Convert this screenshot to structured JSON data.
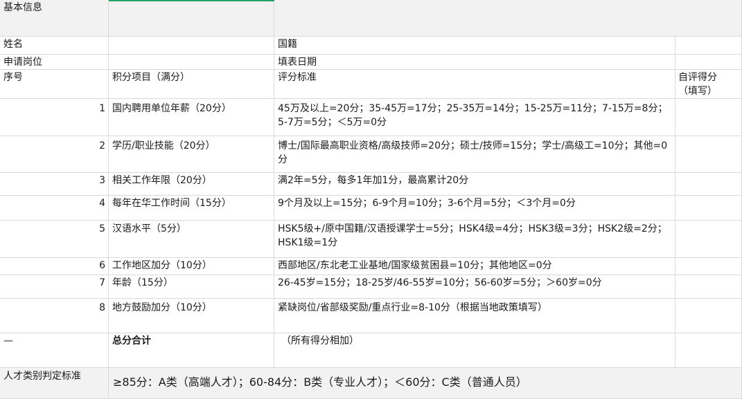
{
  "sheet": {
    "section_title": "基本信息",
    "name_label": "姓名",
    "nationality_label": "国籍",
    "position_label": "申请岗位",
    "date_label": "填表日期",
    "headers": {
      "index": "序号",
      "item": "积分项目（满分）",
      "criteria": "评分标准",
      "self_score": "自评得分（填写）"
    },
    "rows": [
      {
        "no": "1",
        "item": "国内聘用单位年薪（20分）",
        "criteria": "45万及以上=20分；35-45万=17分；25-35万=14分；15-25万=11分；7-15万=8分；5-7万=5分；＜5万=0分"
      },
      {
        "no": "2",
        "item": "学历/职业技能（20分）",
        "criteria": "博士/国际最高职业资格/高级技师=20分；硕士/技师=15分；学士/高级工=10分；其他=0分"
      },
      {
        "no": "3",
        "item": "相关工作年限（20分）",
        "criteria": "满2年=5分，每多1年加1分，最高累计20分"
      },
      {
        "no": "4",
        "item": "每年在华工作时间（15分）",
        "criteria": "9个月及以上=15分；6-9个月=10分；3-6个月=5分；＜3个月=0分"
      },
      {
        "no": "5",
        "item": "汉语水平（5分）",
        "criteria": "HSK5级+/原中国籍/汉语授课学士=5分；HSK4级=4分；HSK3级=3分；HSK2级=2分；HSK1级=1分"
      },
      {
        "no": "6",
        "item": "工作地区加分（10分）",
        "criteria": "西部地区/东北老工业基地/国家级贫困县=10分；其他地区=0分"
      },
      {
        "no": "7",
        "item": "年龄（15分）",
        "criteria": "26-45岁=15分；18-25岁/46-55岁=10分；56-60岁=5分；＞60岁=0分"
      },
      {
        "no": "8",
        "item": "地方鼓励加分（10分）",
        "criteria": "紧缺岗位/省部级奖励/重点行业=8-10分（根据当地政策填写）"
      }
    ],
    "total": {
      "no": "—",
      "item": "总分合计",
      "criteria": "（所有得分相加）"
    },
    "category": {
      "label": "人才类别判定标准",
      "text": "≥85分：A类（高端人才）；60-84分：B类（专业人才）；＜60分：C类（普通人员）"
    }
  }
}
